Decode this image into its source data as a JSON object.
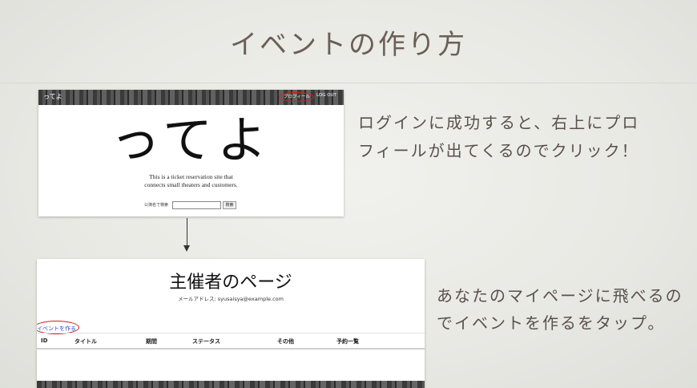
{
  "slide": {
    "title": "イベントの作り方",
    "desc1_lines": [
      "ログインに成功すると、右上にプロ",
      "フィールが出てくるのでクリック！"
    ],
    "desc2_lines": [
      "あなたのマイページに飛べるの",
      "でイベントを作るをタップ。"
    ]
  },
  "shot1": {
    "brand": "ってよ",
    "profile_link": "プロフィール",
    "logout_link": "LOG OUT",
    "hero": "ってよ",
    "tagline_lines": [
      "This is a ticket reservation site that",
      "connects small theaters and customers."
    ],
    "search_label": "公演名で検索",
    "search_value": "",
    "search_button": "検索"
  },
  "shot2": {
    "heading": "主催者のページ",
    "mail_label": "メールアドレス:",
    "mail_value": "syusaisya@example.com",
    "create_link": "イベントを作る",
    "columns": [
      "ID",
      "タイトル",
      "期間",
      "ステータス",
      "その他",
      "予約一覧"
    ]
  },
  "colors": {
    "highlight_ring": "#d42020",
    "link": "#2255cc"
  }
}
